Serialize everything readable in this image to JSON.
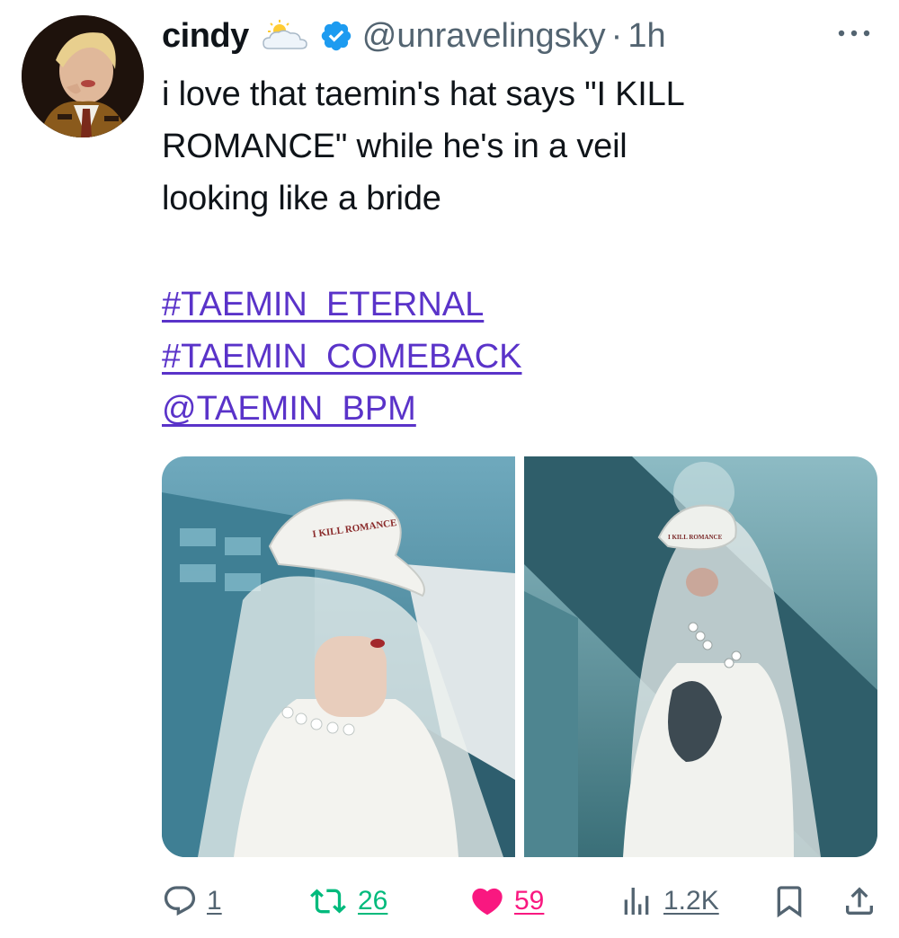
{
  "tweet": {
    "display_name": "cindy",
    "handle": "@unravelingsky",
    "separator": "·",
    "time": "1h",
    "text_lines": [
      "i love that taemin's hat says \"I KILL",
      "ROMANCE\" while he's in a veil",
      "looking like a bride"
    ],
    "hashtags": [
      "#TAEMIN_ETERNAL",
      "#TAEMIN_COMEBACK"
    ],
    "mention": "@TAEMIN_BPM",
    "media": [
      {
        "hat_text": "I KILL ROMANCE"
      },
      {
        "hat_text": "I KILL ROMANCE"
      }
    ]
  },
  "actions": {
    "replies": "1",
    "reposts": "26",
    "likes": "59",
    "views": "1.2K"
  },
  "colors": {
    "link": "#5a33c9",
    "repost": "#00ba7c",
    "like": "#f91880",
    "muted": "#536471",
    "verified": "#1d9bf0"
  },
  "icons": [
    "cloud-sun-emoji-icon",
    "verified-badge-icon",
    "more-icon",
    "reply-icon",
    "repost-icon",
    "like-icon",
    "views-icon",
    "bookmark-icon",
    "share-icon"
  ]
}
